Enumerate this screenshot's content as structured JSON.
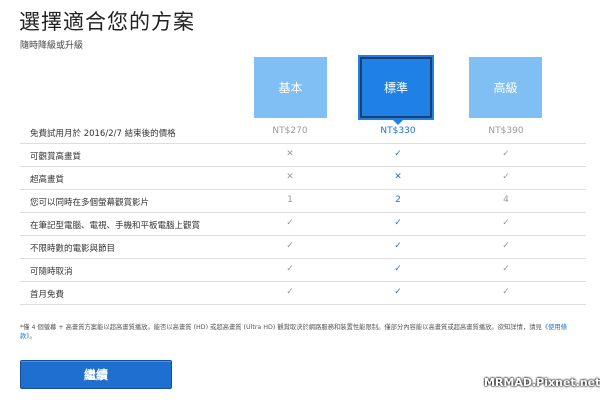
{
  "header": {
    "title": "選擇適合您的方案",
    "subtitle": "隨時降級或升級"
  },
  "plans": [
    {
      "name": "基本",
      "selected": false
    },
    {
      "name": "標準",
      "selected": true
    },
    {
      "name": "高級",
      "selected": false
    }
  ],
  "colors": {
    "plan_unselected": "#80bff3",
    "plan_selected": "#1f80e6",
    "accent_text": "#1f73d6",
    "button": "#1f6fd0"
  },
  "rows": [
    {
      "label": "免費試用月於 2016/2/7 結束後的價格",
      "values": [
        "NT$270",
        "NT$330",
        "NT$390"
      ]
    },
    {
      "label": "可觀賞高畫質",
      "values": [
        "✕",
        "✓",
        "✓"
      ]
    },
    {
      "label": "超高畫質",
      "values": [
        "✕",
        "✕",
        "✓"
      ]
    },
    {
      "label": "您可以同時在多個螢幕觀賞影片",
      "values": [
        "1",
        "2",
        "4"
      ]
    },
    {
      "label": "在筆記型電腦、電視、手機和平板電腦上觀賞",
      "values": [
        "✓",
        "✓",
        "✓"
      ]
    },
    {
      "label": "不限時數的電影與節目",
      "values": [
        "✓",
        "✓",
        "✓"
      ]
    },
    {
      "label": "可隨時取消",
      "values": [
        "✓",
        "✓",
        "✓"
      ]
    },
    {
      "label": "首月免費",
      "values": [
        "✓",
        "✓",
        "✓"
      ]
    }
  ],
  "footnote": {
    "text": "*僅 4 個螢幕 + 高畫質方案能以超高畫質播放。能否以高畫質 (HD) 或超高畫質 (Ultra HD) 觀賞取決於網路服務和裝置性能限制。僅部分內容能以高畫質或超高畫質播放。欲知詳情，請見",
    "link": "《使用條款》",
    "end": "。"
  },
  "cta": {
    "label": "繼續"
  },
  "watermark": "MRMAD.Pixnet.net"
}
